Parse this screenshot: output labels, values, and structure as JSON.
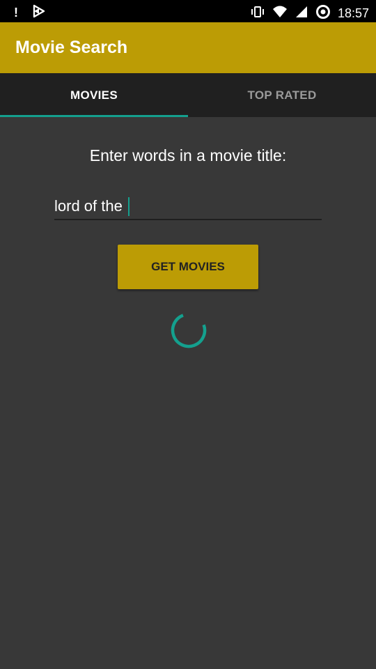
{
  "status_bar": {
    "time": "18:57",
    "icons": [
      "alert-icon",
      "play-store-icon",
      "vibrate-icon",
      "wifi-icon",
      "signal-icon",
      "sync-icon"
    ]
  },
  "app_bar": {
    "title": "Movie Search"
  },
  "tabs": [
    {
      "label": "MOVIES",
      "active": true
    },
    {
      "label": "TOP RATED",
      "active": false
    }
  ],
  "search": {
    "prompt": "Enter words in a movie title:",
    "value": "lord of the",
    "button_label": "GET MOVIES"
  },
  "colors": {
    "accent": "#BC9C05",
    "tab_indicator": "#14A08E",
    "background": "#383838",
    "tab_bar": "#202020"
  },
  "loading": true
}
